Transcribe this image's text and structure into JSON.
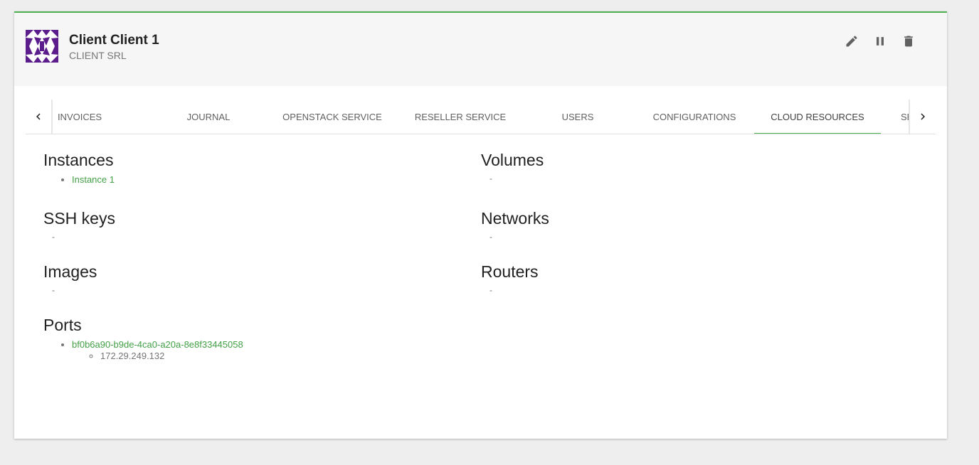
{
  "client": {
    "name": "Client Client 1",
    "company": "CLIENT SRL"
  },
  "actions": {
    "edit_icon": "pencil-icon",
    "suspend_icon": "pause-icon",
    "delete_icon": "trash-icon"
  },
  "tabs": [
    {
      "label": "Invoices"
    },
    {
      "label": "Journal"
    },
    {
      "label": "Openstack service"
    },
    {
      "label": "Reseller service"
    },
    {
      "label": "Users"
    },
    {
      "label": "Configurations"
    },
    {
      "label": "Cloud resources",
      "active": true
    },
    {
      "label": "Se"
    }
  ],
  "sections": {
    "instances": {
      "title": "Instances",
      "items": [
        "Instance 1"
      ]
    },
    "volumes": {
      "title": "Volumes",
      "empty": "-"
    },
    "ssh_keys": {
      "title": "SSH keys",
      "empty": "-"
    },
    "networks": {
      "title": "Networks",
      "empty": "-"
    },
    "images": {
      "title": "Images",
      "empty": "-"
    },
    "routers": {
      "title": "Routers",
      "empty": "-"
    },
    "ports": {
      "title": "Ports",
      "items": [
        {
          "id": "bf0b6a90-b9de-4ca0-a20a-8e8f33445058",
          "ips": [
            "172.29.249.132"
          ]
        }
      ]
    }
  },
  "colors": {
    "accent": "#4caf50",
    "link": "#43a047",
    "avatar": "#5b1c8c"
  }
}
